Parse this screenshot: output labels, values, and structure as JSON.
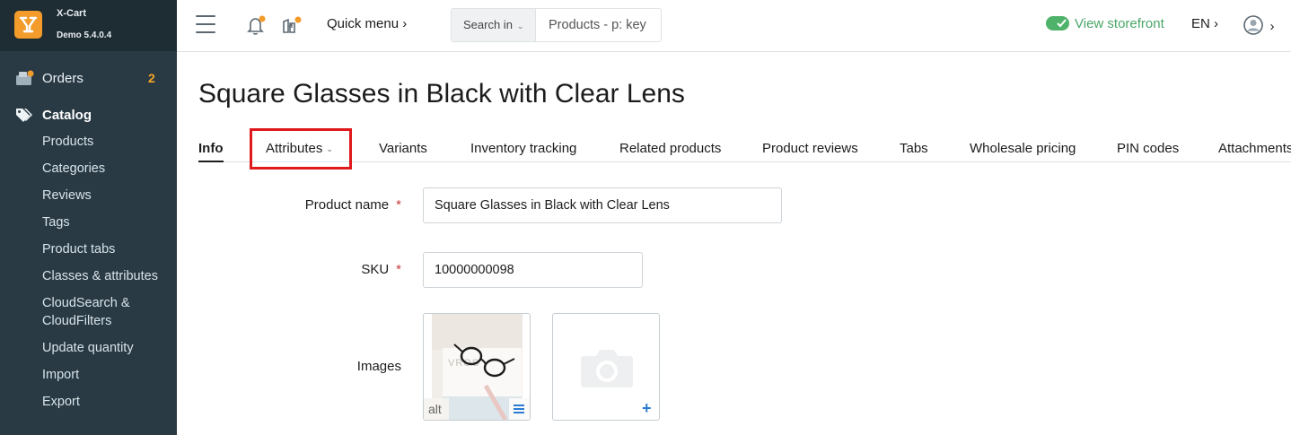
{
  "brand": {
    "name": "X-Cart",
    "version": "Demo 5.4.0.4"
  },
  "sidebar": {
    "orders": {
      "label": "Orders",
      "count": "2"
    },
    "catalog": {
      "label": "Catalog"
    },
    "items": [
      {
        "label": "Products"
      },
      {
        "label": "Categories"
      },
      {
        "label": "Reviews"
      },
      {
        "label": "Tags"
      },
      {
        "label": "Product tabs"
      },
      {
        "label": "Classes & attributes"
      },
      {
        "label": "CloudSearch & CloudFilters",
        "line1": "CloudSearch &",
        "line2": "CloudFilters"
      },
      {
        "label": "Update quantity"
      },
      {
        "label": "Import"
      },
      {
        "label": "Export"
      }
    ]
  },
  "header": {
    "quick_menu": "Quick menu ›",
    "search_scope": "Search in",
    "search_placeholder": "Products - p: key",
    "view_storefront": "View storefront",
    "language": "EN ›",
    "account_chevron": "›"
  },
  "page": {
    "title": "Square Glasses in Black with Clear Lens"
  },
  "tabs": [
    {
      "label": "Info",
      "active": true
    },
    {
      "label": "Attributes",
      "dropdown": true
    },
    {
      "label": "Variants"
    },
    {
      "label": "Inventory tracking"
    },
    {
      "label": "Related products"
    },
    {
      "label": "Product reviews"
    },
    {
      "label": "Tabs"
    },
    {
      "label": "Wholesale pricing"
    },
    {
      "label": "PIN codes"
    },
    {
      "label": "Attachments"
    }
  ],
  "form": {
    "product_name": {
      "label": "Product name",
      "required_mark": "*",
      "value": "Square Glasses in Black with Clear Lens"
    },
    "sku": {
      "label": "SKU",
      "required_mark": "*",
      "value": "10000000098"
    },
    "images": {
      "label": "Images",
      "alt_label": "alt"
    }
  },
  "colors": {
    "sidebar_bg": "#293a45",
    "brand_orange": "#f39c2b",
    "storefront_green": "#4aa667",
    "highlight_red": "#e0191d",
    "required_red": "#c73b3b",
    "accent_blue": "#2a7bd1"
  }
}
